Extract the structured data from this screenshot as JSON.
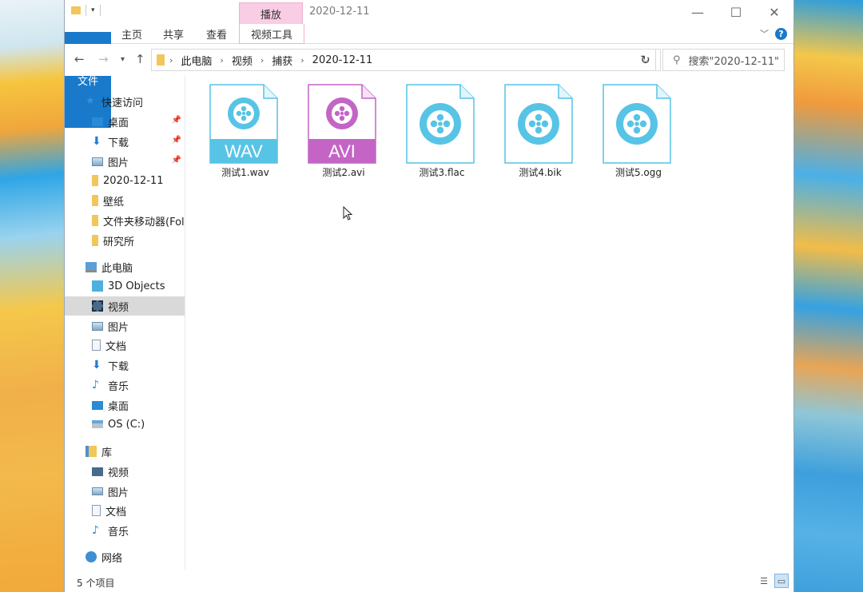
{
  "window": {
    "title": "2020-12-11",
    "context_tab": "播放",
    "ribbon_tabs": [
      "文件",
      "主页",
      "共享",
      "查看",
      "视频工具"
    ],
    "accent": "#1979ca",
    "context_color": "#f9cde4"
  },
  "addressbar": {
    "crumbs": [
      "此电脑",
      "视频",
      "捕获",
      "2020-12-11"
    ],
    "search_placeholder": "搜索\"2020-12-11\""
  },
  "sidebar": {
    "quick_access": {
      "label": "快速访问",
      "items": [
        {
          "label": "桌面",
          "pinned": true
        },
        {
          "label": "下载",
          "pinned": true
        },
        {
          "label": "图片",
          "pinned": true
        },
        {
          "label": "2020-12-11",
          "pinned": false
        },
        {
          "label": "壁纸",
          "pinned": false
        },
        {
          "label": "文件夹移动器(Fol",
          "pinned": false
        },
        {
          "label": "研究所",
          "pinned": false
        }
      ]
    },
    "this_pc": {
      "label": "此电脑",
      "items": [
        "3D Objects",
        "视频",
        "图片",
        "文档",
        "下载",
        "音乐",
        "桌面",
        "OS (C:)"
      ],
      "selected": "视频"
    },
    "library": {
      "label": "库",
      "items": [
        "视频",
        "图片",
        "文档",
        "音乐"
      ]
    },
    "network": {
      "label": "网络"
    }
  },
  "files": [
    {
      "name": "测试1.wav",
      "badge": "WAV",
      "color": "#57c4e5"
    },
    {
      "name": "测试2.avi",
      "badge": "AVI",
      "color": "#c465c6"
    },
    {
      "name": "测试3.flac",
      "badge": "",
      "color": "#57c4e5"
    },
    {
      "name": "测试4.bik",
      "badge": "",
      "color": "#57c4e5"
    },
    {
      "name": "测试5.ogg",
      "badge": "",
      "color": "#57c4e5"
    }
  ],
  "status": {
    "item_count": "5 个项目"
  }
}
